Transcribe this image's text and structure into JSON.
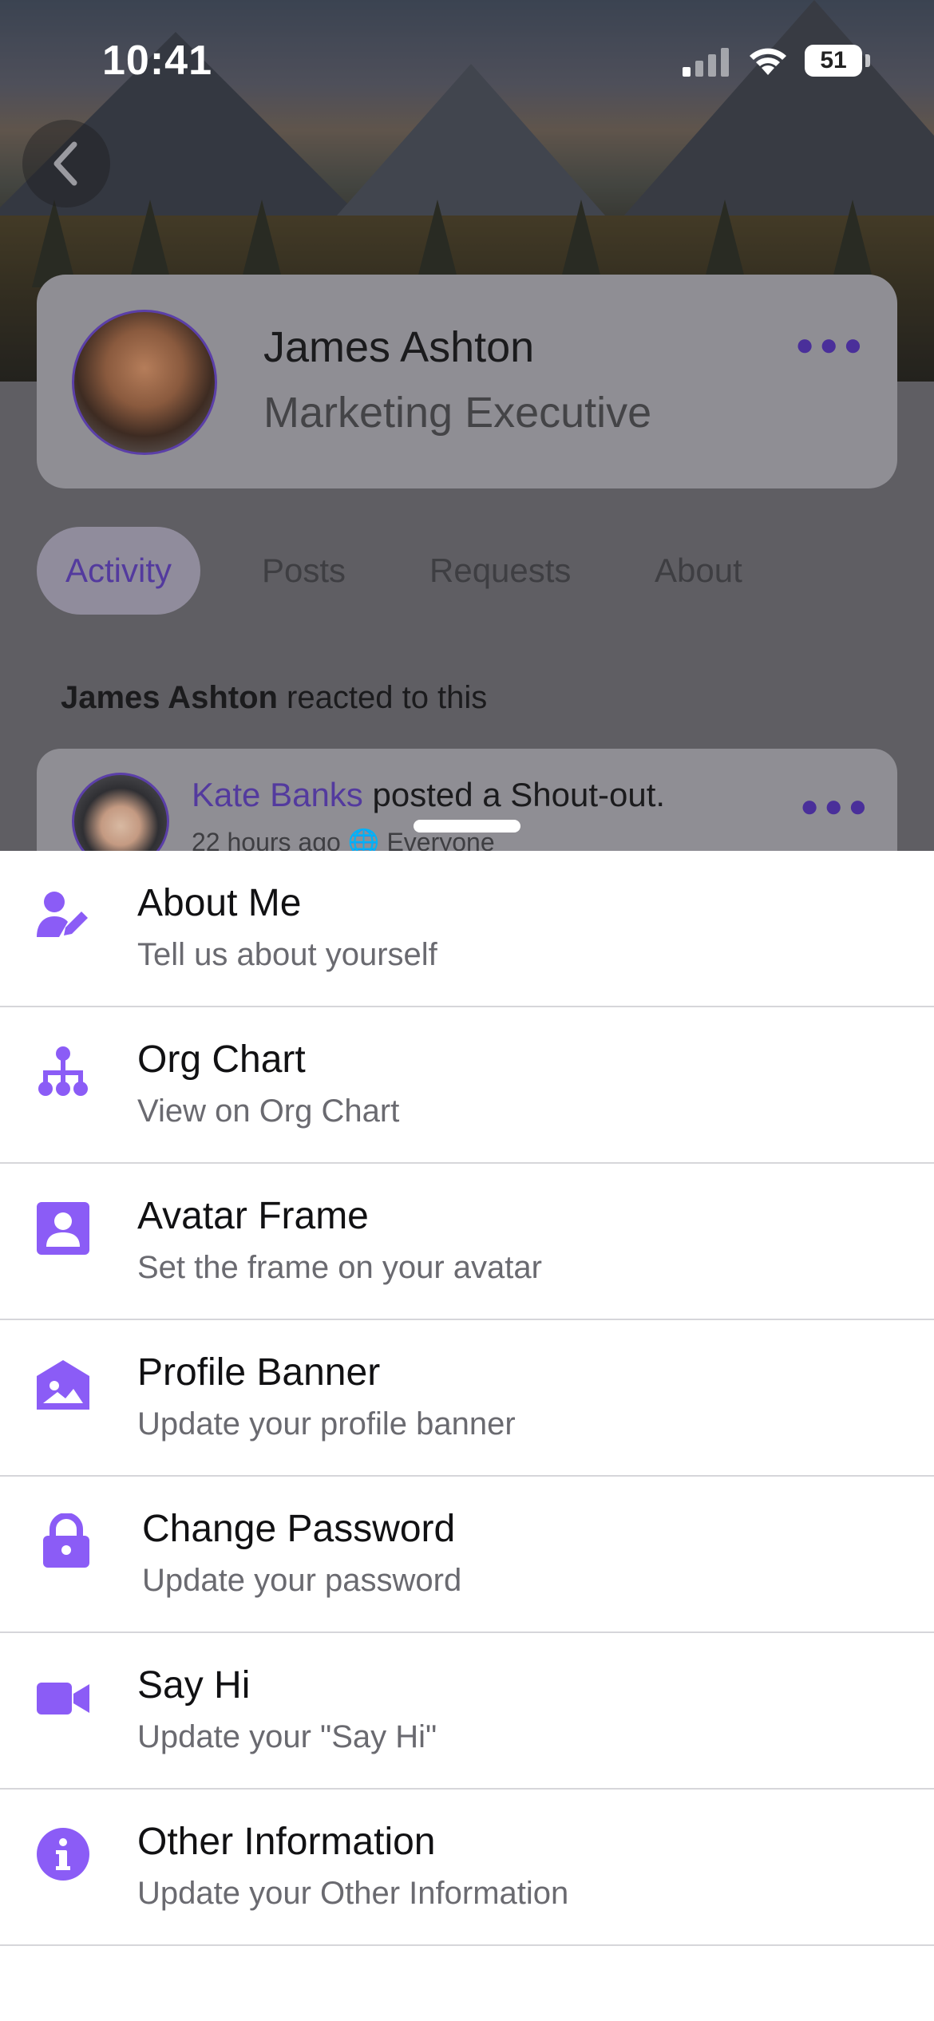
{
  "status_bar": {
    "time": "10:41",
    "battery": "51"
  },
  "profile": {
    "name": "James Ashton",
    "role": "Marketing Executive",
    "more_icon": "ellipsis-icon"
  },
  "tabs": [
    {
      "label": "Activity",
      "active": true
    },
    {
      "label": "Posts",
      "active": false
    },
    {
      "label": "Requests",
      "active": false
    },
    {
      "label": "About",
      "active": false
    }
  ],
  "feed": {
    "header_name": "James Ashton",
    "header_suffix": " reacted to this",
    "post_author": "Kate Banks",
    "post_action": " posted a Shout-out.",
    "post_meta_time": "22 hours ago",
    "post_meta_audience": "Everyone"
  },
  "menu": [
    {
      "icon": "user-edit-icon",
      "title": "About Me",
      "subtitle": "Tell us about yourself"
    },
    {
      "icon": "org-chart-icon",
      "title": "Org Chart",
      "subtitle": "View on Org Chart"
    },
    {
      "icon": "avatar-frame-icon",
      "title": "Avatar Frame",
      "subtitle": "Set the frame on your avatar"
    },
    {
      "icon": "banner-image-icon",
      "title": "Profile Banner",
      "subtitle": "Update your profile banner"
    },
    {
      "icon": "lock-icon",
      "title": "Change Password",
      "subtitle": "Update your password"
    },
    {
      "icon": "video-camera-icon",
      "title": "Say Hi",
      "subtitle": "Update your \"Say Hi\""
    },
    {
      "icon": "info-icon",
      "title": "Other Information",
      "subtitle": "Update your Other Information"
    }
  ],
  "colors": {
    "accent": "#8b5cf6",
    "accent_dark": "#533a9e",
    "sheet": "#ffffff"
  }
}
